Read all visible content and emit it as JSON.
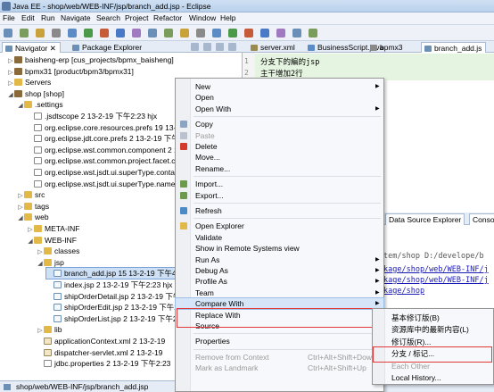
{
  "window": {
    "title": "Java EE - shop/web/WEB-INF/jsp/branch_add.jsp - Eclipse"
  },
  "menubar": [
    "File",
    "Edit",
    "Run",
    "Navigate",
    "Search",
    "Project",
    "Refactor",
    "Window",
    "Help"
  ],
  "nav_tabs": {
    "navigator": "Navigator",
    "package_explorer": "Package Explorer"
  },
  "tree": [
    {
      "text": "baisheng-erp [cus_projects/bpmx_baisheng]",
      "icon": "project-icon",
      "depth": 0,
      "tw": "▷"
    },
    {
      "text": "bpmx31 [product/bpm3/bpmx31]",
      "icon": "project-icon",
      "depth": 0,
      "tw": "▷"
    },
    {
      "text": "Servers",
      "icon": "folder-icon",
      "depth": 0,
      "tw": "▷"
    },
    {
      "text": "shop [shop]",
      "icon": "project-icon",
      "depth": 0,
      "tw": "◢"
    },
    {
      "text": ".settings",
      "icon": "folder-icon",
      "depth": 1,
      "tw": "◢"
    },
    {
      "text": ".jsdtscope 2  13-2-19 下午2:23  hjx",
      "icon": "file-icon",
      "depth": 2,
      "tw": ""
    },
    {
      "text": "org.eclipse.core.resources.prefs 19  13-2",
      "icon": "file-icon",
      "depth": 2,
      "tw": ""
    },
    {
      "text": "org.eclipse.jdt.core.prefs 2  13-2-19 下午",
      "icon": "file-icon",
      "depth": 2,
      "tw": ""
    },
    {
      "text": "org.eclipse.wst.common.component 2  13-",
      "icon": "file-icon",
      "depth": 2,
      "tw": ""
    },
    {
      "text": "org.eclipse.wst.common.project.facet.cor",
      "icon": "file-icon",
      "depth": 2,
      "tw": ""
    },
    {
      "text": "org.eclipse.wst.jsdt.ui.superType.containe",
      "icon": "file-icon",
      "depth": 2,
      "tw": ""
    },
    {
      "text": "org.eclipse.wst.jsdt.ui.superType.name 2",
      "icon": "file-icon",
      "depth": 2,
      "tw": ""
    },
    {
      "text": "src",
      "icon": "folder-icon",
      "depth": 1,
      "tw": "▷"
    },
    {
      "text": "tags",
      "icon": "folder-icon",
      "depth": 1,
      "tw": "▷"
    },
    {
      "text": "web",
      "icon": "folder-icon",
      "depth": 1,
      "tw": "◢"
    },
    {
      "text": "META-INF",
      "icon": "folder-icon",
      "depth": 2,
      "tw": "▷"
    },
    {
      "text": "WEB-INF",
      "icon": "folder-icon",
      "depth": 2,
      "tw": "◢"
    },
    {
      "text": "classes",
      "icon": "folder-icon",
      "depth": 3,
      "tw": "▷"
    },
    {
      "text": "jsp",
      "icon": "folder-icon",
      "depth": 3,
      "tw": "◢"
    },
    {
      "text": "branch_add.jsp 15  13-2-19 下午4:1",
      "icon": "jsp-icon",
      "depth": 4,
      "tw": "",
      "selected": true
    },
    {
      "text": "index.jsp 2  13-2-19 下午2:23  hjx",
      "icon": "jsp-icon",
      "depth": 4,
      "tw": ""
    },
    {
      "text": "shipOrderDetail.jsp 2  13-2-19 下午",
      "icon": "jsp-icon",
      "depth": 4,
      "tw": ""
    },
    {
      "text": "shipOrderEdit.jsp 2  13-2-19 下午2:",
      "icon": "jsp-icon",
      "depth": 4,
      "tw": ""
    },
    {
      "text": "shipOrderList.jsp 2  13-2-19 下午2:",
      "icon": "jsp-icon",
      "depth": 4,
      "tw": ""
    },
    {
      "text": "lib",
      "icon": "folder-icon",
      "depth": 3,
      "tw": "▷"
    },
    {
      "text": "applicationContext.xml 2  13-2-19",
      "icon": "xml-icon",
      "depth": 3,
      "tw": ""
    },
    {
      "text": "dispatcher-servlet.xml 2  13-2-19",
      "icon": "xml-icon",
      "depth": 3,
      "tw": ""
    },
    {
      "text": "jdbc.properties 2  13-2-19 下午2:23",
      "icon": "file-icon",
      "depth": 3,
      "tw": ""
    }
  ],
  "editor_tabs": [
    "server.xml",
    "BusinessScript.java",
    "bpmx3",
    "branch_add.js"
  ],
  "editor_lines": [
    "分支下的編的jsp",
    "主干增加2行"
  ],
  "console_tabs": [
    "Data Source Explorer",
    "Console"
  ],
  "console_lines": [
    {
      "text": "tem/shop D:/develope/b",
      "link": false
    },
    {
      "text": "kage/shop/web/WEB-INF/j",
      "link": true
    },
    {
      "text": "kage/shop/web/WEB-INF/j",
      "link": true
    },
    {
      "text": "kage/shop",
      "link": true
    }
  ],
  "context_menu": [
    {
      "label": "New",
      "arrow": true
    },
    {
      "label": "Open"
    },
    {
      "label": "Open With",
      "arrow": true
    },
    {
      "sep": true
    },
    {
      "label": "Copy",
      "icon": "copy-icon"
    },
    {
      "label": "Paste",
      "icon": "paste-icon",
      "disabled": true
    },
    {
      "label": "Delete",
      "icon": "delete-icon"
    },
    {
      "label": "Move..."
    },
    {
      "label": "Rename..."
    },
    {
      "sep": true
    },
    {
      "label": "Import...",
      "icon": "import-icon"
    },
    {
      "label": "Export...",
      "icon": "export-icon"
    },
    {
      "sep": true
    },
    {
      "label": "Refresh",
      "icon": "refresh-icon"
    },
    {
      "sep": true
    },
    {
      "label": "Open Explorer",
      "icon": "explorer-icon"
    },
    {
      "label": "Validate"
    },
    {
      "label": "Show in Remote Systems view"
    },
    {
      "label": "Run As",
      "arrow": true
    },
    {
      "label": "Debug As",
      "arrow": true
    },
    {
      "label": "Profile As",
      "arrow": true
    },
    {
      "label": "Team",
      "arrow": true
    },
    {
      "label": "Compare With",
      "arrow": true,
      "hot": true
    },
    {
      "label": "Replace With",
      "arrow": true
    },
    {
      "label": "Source",
      "arrow": true
    },
    {
      "sep": true
    },
    {
      "label": "Properties"
    },
    {
      "sep": true
    },
    {
      "label": "Remove from Context",
      "shortcut": "Ctrl+Alt+Shift+Down",
      "disabled": true
    },
    {
      "label": "Mark as Landmark",
      "shortcut": "Ctrl+Alt+Shift+Up",
      "disabled": true
    }
  ],
  "submenu": [
    {
      "label": "基本修订版(B)"
    },
    {
      "label": "资源库中的最新内容(L)"
    },
    {
      "label": "修订版(R)..."
    },
    {
      "label": "分支 / 标记...",
      "boxed": true
    },
    {
      "label": "Each Other",
      "disabled": true
    },
    {
      "label": "Local History..."
    }
  ],
  "statusbar": {
    "text": "shop/web/WEB-INF/jsp/branch_add.jsp"
  },
  "colors": {
    "highlight_border": "#e23a3a",
    "selection": "#cde0f6",
    "link": "#1a1ab5"
  }
}
